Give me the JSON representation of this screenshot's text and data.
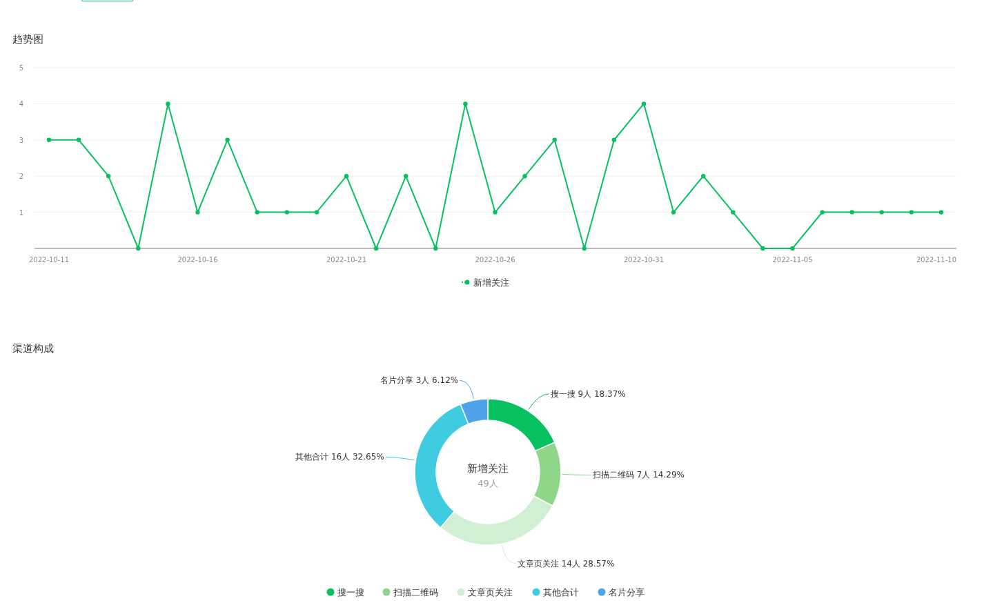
{
  "trend": {
    "title": "趋势图",
    "chart_data": {
      "type": "line",
      "categories": [
        "2022-10-11",
        null,
        null,
        null,
        null,
        "2022-10-16",
        null,
        null,
        null,
        null,
        "2022-10-21",
        null,
        null,
        null,
        null,
        "2022-10-26",
        null,
        null,
        null,
        null,
        "2022-10-31",
        null,
        null,
        null,
        null,
        "2022-11-05",
        null,
        null,
        null,
        null,
        "2022-11-10"
      ],
      "series": [
        {
          "name": "新增关注",
          "color": "#07c160",
          "marker": "circle",
          "values": [
            3,
            3,
            2,
            0,
            4,
            1,
            3,
            1,
            1,
            1,
            2,
            0,
            2,
            0,
            4,
            1,
            2,
            3,
            0,
            3,
            4,
            1,
            2,
            1,
            0,
            0,
            1,
            1,
            1,
            1,
            1
          ]
        }
      ],
      "ylim": [
        0,
        5
      ],
      "yticks": [
        1,
        2,
        3,
        4,
        5
      ],
      "grid": true,
      "legend": "bottom"
    }
  },
  "channels": {
    "title": "渠道构成",
    "center_title": "新增关注",
    "center_value": "49人",
    "chart_data": {
      "type": "donut",
      "categories": [
        "搜一搜",
        "扫描二维码",
        "文章页关注",
        "其他合计",
        "名片分享"
      ],
      "colors": [
        "#07c160",
        "#8ed68a",
        "#d1efd3",
        "#40cce0",
        "#4fa3ea"
      ],
      "series": [
        {
          "values": [
            18.37,
            14.29,
            28.57,
            32.65,
            6.12
          ]
        }
      ],
      "value_labels": [
        "搜一搜 9人 18.37%",
        "扫描二维码 7人 14.29%",
        "文章页关注 14人 28.57%",
        "其他合计 16人 32.65%",
        "名片分享 3人 6.12%"
      ],
      "legend": "bottom"
    }
  }
}
